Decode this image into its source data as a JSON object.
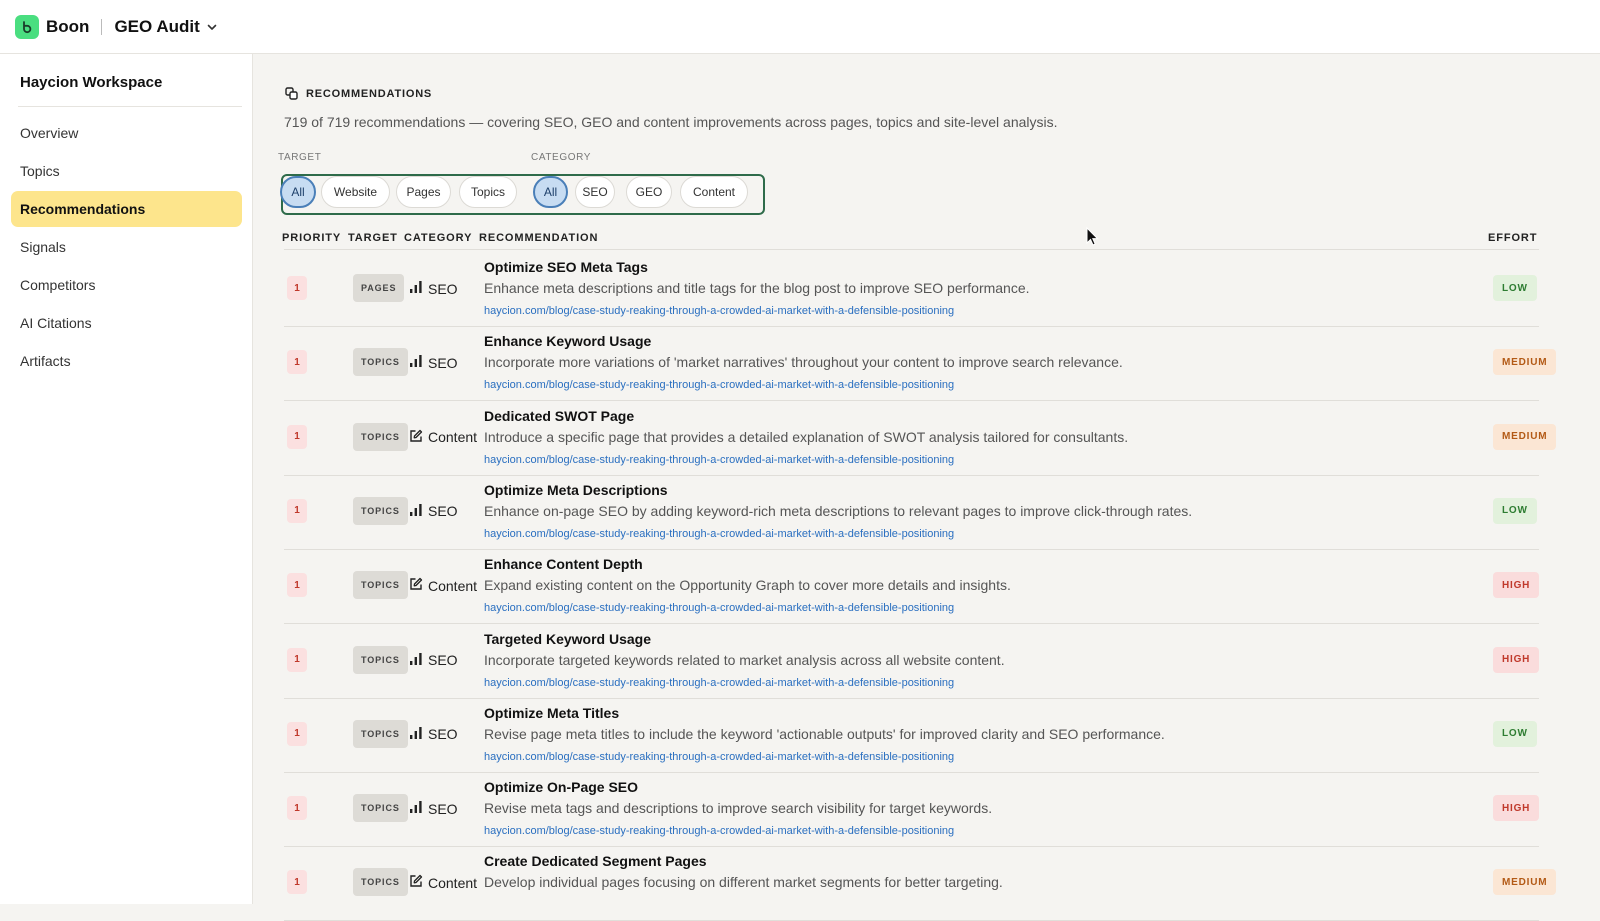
{
  "header": {
    "brand": "Boon",
    "project": "GEO Audit",
    "brand_color": "#4ade80"
  },
  "sidebar": {
    "workspace": "Haycion Workspace",
    "items": [
      {
        "label": "Overview"
      },
      {
        "label": "Topics"
      },
      {
        "label": "Recommendations",
        "active": true
      },
      {
        "label": "Signals"
      },
      {
        "label": "Competitors"
      },
      {
        "label": "AI Citations"
      },
      {
        "label": "Artifacts"
      }
    ]
  },
  "main": {
    "section_title": "RECOMMENDATIONS",
    "summary": "719 of 719 recommendations — covering SEO, GEO and content improvements across pages, topics and site-level analysis.",
    "filters": {
      "target_label": "TARGET",
      "category_label": "CATEGORY",
      "target": [
        "All",
        "Website",
        "Pages",
        "Topics"
      ],
      "category": [
        "All",
        "SEO",
        "GEO",
        "Content"
      ],
      "target_selected": "All",
      "category_selected": "All"
    },
    "columns": {
      "priority": "PRIORITY",
      "target": "TARGET",
      "category": "CATEGORY",
      "recommendation": "RECOMMENDATION",
      "effort": "EFFORT"
    },
    "rows": [
      {
        "priority": "1",
        "target": "PAGES",
        "category": "SEO",
        "category_icon": "bar-chart-icon",
        "title": "Optimize SEO Meta Tags",
        "description": "Enhance meta descriptions and title tags for the blog post to improve SEO performance.",
        "url": "haycion.com/blog/case-study-reaking-through-a-crowded-ai-market-with-a-defensible-positioning",
        "effort": "LOW"
      },
      {
        "priority": "1",
        "target": "TOPICS",
        "category": "SEO",
        "category_icon": "bar-chart-icon",
        "title": "Enhance Keyword Usage",
        "description": "Incorporate more variations of 'market narratives' throughout your content to improve search relevance.",
        "url": "haycion.com/blog/case-study-reaking-through-a-crowded-ai-market-with-a-defensible-positioning",
        "effort": "MEDIUM"
      },
      {
        "priority": "1",
        "target": "TOPICS",
        "category": "Content",
        "category_icon": "edit-icon",
        "title": "Dedicated SWOT Page",
        "description": "Introduce a specific page that provides a detailed explanation of SWOT analysis tailored for consultants.",
        "url": "haycion.com/blog/case-study-reaking-through-a-crowded-ai-market-with-a-defensible-positioning",
        "effort": "MEDIUM"
      },
      {
        "priority": "1",
        "target": "TOPICS",
        "category": "SEO",
        "category_icon": "bar-chart-icon",
        "title": "Optimize Meta Descriptions",
        "description": "Enhance on-page SEO by adding keyword-rich meta descriptions to relevant pages to improve click-through rates.",
        "url": "haycion.com/blog/case-study-reaking-through-a-crowded-ai-market-with-a-defensible-positioning",
        "effort": "LOW"
      },
      {
        "priority": "1",
        "target": "TOPICS",
        "category": "Content",
        "category_icon": "edit-icon",
        "title": "Enhance Content Depth",
        "description": "Expand existing content on the Opportunity Graph to cover more details and insights.",
        "url": "haycion.com/blog/case-study-reaking-through-a-crowded-ai-market-with-a-defensible-positioning",
        "effort": "HIGH"
      },
      {
        "priority": "1",
        "target": "TOPICS",
        "category": "SEO",
        "category_icon": "bar-chart-icon",
        "title": "Targeted Keyword Usage",
        "description": "Incorporate targeted keywords related to market analysis across all website content.",
        "url": "haycion.com/blog/case-study-reaking-through-a-crowded-ai-market-with-a-defensible-positioning",
        "effort": "HIGH"
      },
      {
        "priority": "1",
        "target": "TOPICS",
        "category": "SEO",
        "category_icon": "bar-chart-icon",
        "title": "Optimize Meta Titles",
        "description": "Revise page meta titles to include the keyword 'actionable outputs' for improved clarity and SEO performance.",
        "url": "haycion.com/blog/case-study-reaking-through-a-crowded-ai-market-with-a-defensible-positioning",
        "effort": "LOW"
      },
      {
        "priority": "1",
        "target": "TOPICS",
        "category": "SEO",
        "category_icon": "bar-chart-icon",
        "title": "Optimize On-Page SEO",
        "description": "Revise meta tags and descriptions to improve search visibility for target keywords.",
        "url": "haycion.com/blog/case-study-reaking-through-a-crowded-ai-market-with-a-defensible-positioning",
        "effort": "HIGH"
      },
      {
        "priority": "1",
        "target": "TOPICS",
        "category": "Content",
        "category_icon": "edit-icon",
        "title": "Create Dedicated Segment Pages",
        "description": "Develop individual pages focusing on different market segments for better targeting.",
        "url": "",
        "effort": "MEDIUM"
      }
    ]
  }
}
